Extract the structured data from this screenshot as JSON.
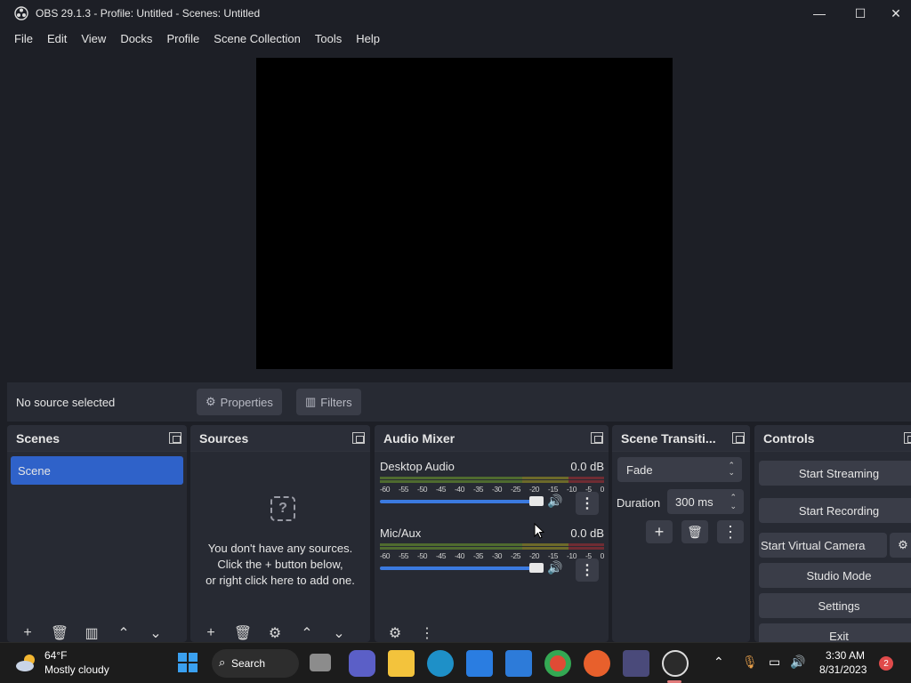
{
  "window": {
    "title": "OBS 29.1.3 - Profile: Untitled - Scenes: Untitled",
    "minimize": "—",
    "maximize": "☐",
    "close": "✕"
  },
  "menu": [
    "File",
    "Edit",
    "View",
    "Docks",
    "Profile",
    "Scene Collection",
    "Tools",
    "Help"
  ],
  "context_bar": {
    "status": "No source selected",
    "properties_label": "Properties",
    "filters_label": "Filters"
  },
  "scenes": {
    "title": "Scenes",
    "items": [
      "Scene"
    ]
  },
  "sources": {
    "title": "Sources",
    "empty_line1": "You don't have any sources.",
    "empty_line2": "Click the + button below,",
    "empty_line3": "or right click here to add one."
  },
  "audio_mixer": {
    "title": "Audio Mixer",
    "scale": [
      "-60",
      "-55",
      "-50",
      "-45",
      "-40",
      "-35",
      "-30",
      "-25",
      "-20",
      "-15",
      "-10",
      "-5",
      "0"
    ],
    "channels": [
      {
        "name": "Desktop Audio",
        "db": "0.0 dB",
        "volume": 1.0
      },
      {
        "name": "Mic/Aux",
        "db": "0.0 dB",
        "volume": 1.0
      }
    ]
  },
  "transitions": {
    "title": "Scene Transiti...",
    "selected": "Fade",
    "duration_label": "Duration",
    "duration_value": "300 ms"
  },
  "controls": {
    "title": "Controls",
    "start_streaming": "Start Streaming",
    "start_recording": "Start Recording",
    "start_virtual_camera": "Start Virtual Camera",
    "studio_mode": "Studio Mode",
    "settings": "Settings",
    "exit": "Exit"
  },
  "taskbar": {
    "weather_temp": "64°F",
    "weather_desc": "Mostly cloudy",
    "search_label": "Search",
    "time": "3:30 AM",
    "date": "8/31/2023",
    "notification_count": "2"
  },
  "colors": {
    "accent": "#2f62c9",
    "panel": "#272a33",
    "background": "#1d1f26",
    "button": "#3a3d48"
  }
}
